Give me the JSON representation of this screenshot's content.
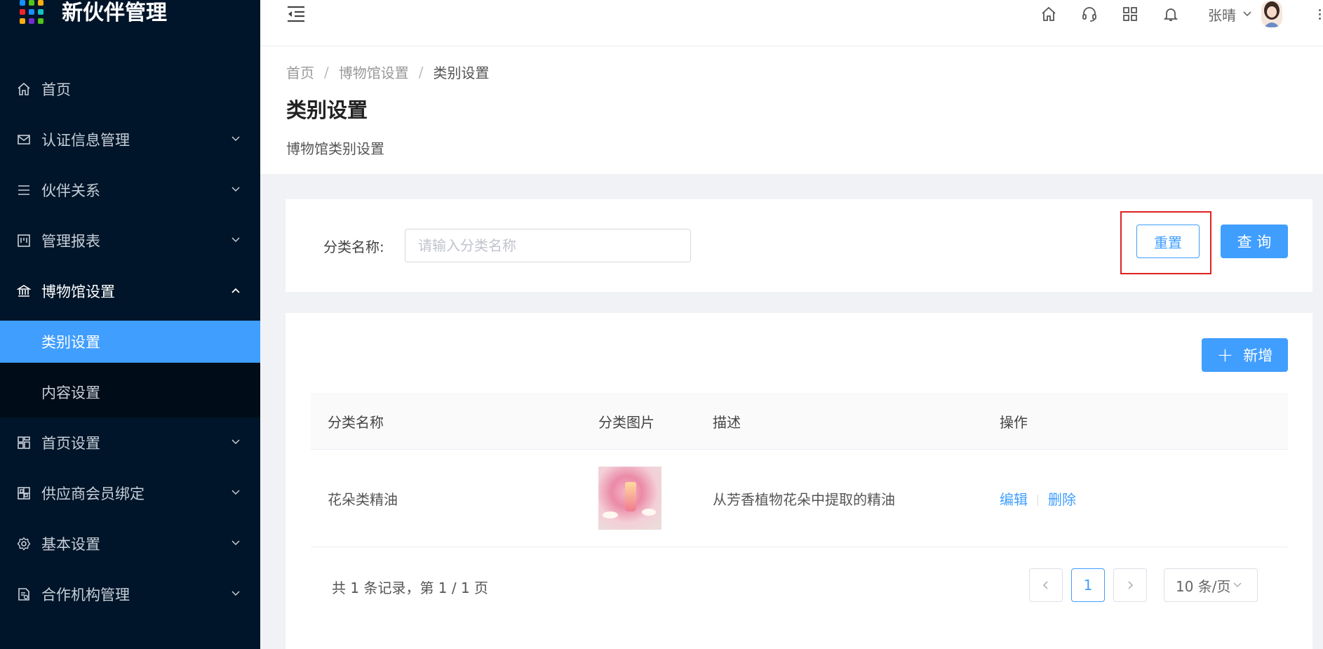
{
  "app": {
    "title": "新伙伴管理",
    "logo_colors": [
      "#1890ff",
      "#52c41a",
      "#faad14",
      "#f5222d",
      "#1890ff",
      "#13c2c2",
      "#faad14",
      "#722ed1",
      "#52c41a"
    ]
  },
  "sidebar": {
    "items": [
      {
        "label": "首页",
        "icon": "home-icon",
        "has_arrow": false
      },
      {
        "label": "认证信息管理",
        "icon": "mail-icon",
        "has_arrow": true
      },
      {
        "label": "伙伴关系",
        "icon": "list-icon",
        "has_arrow": true
      },
      {
        "label": "管理报表",
        "icon": "report-icon",
        "has_arrow": true
      },
      {
        "label": "博物馆设置",
        "icon": "bank-icon",
        "has_arrow": true,
        "open": true
      },
      {
        "label": "首页设置",
        "icon": "layout-icon",
        "has_arrow": true
      },
      {
        "label": "供应商会员绑定",
        "icon": "qrcode-icon",
        "has_arrow": true
      },
      {
        "label": "基本设置",
        "icon": "gear-icon",
        "has_arrow": true
      },
      {
        "label": "合作机构管理",
        "icon": "file-icon",
        "has_arrow": true
      }
    ],
    "submenu": [
      {
        "label": "类别设置",
        "active": true
      },
      {
        "label": "内容设置",
        "active": false
      }
    ]
  },
  "topbar": {
    "username": "张晴"
  },
  "breadcrumb": [
    "首页",
    "博物馆设置",
    "类别设置"
  ],
  "page": {
    "title": "类别设置",
    "description": "博物馆类别设置"
  },
  "search": {
    "label": "分类名称:",
    "placeholder": "请输入分类名称",
    "value": "",
    "reset_label": "重置",
    "query_label": "查 询"
  },
  "toolbar": {
    "add_label": "新增"
  },
  "table": {
    "columns": [
      "分类名称",
      "分类图片",
      "描述",
      "操作"
    ],
    "rows": [
      {
        "name": "花朵类精油",
        "description": "从芳香植物花朵中提取的精油",
        "edit": "编辑",
        "delete": "删除"
      }
    ]
  },
  "pagination": {
    "total_text": "共 1 条记录，第 1 / 1 页",
    "current_page": "1",
    "page_size": "10 条/页"
  },
  "colors": {
    "sidebar_bg": "#001529",
    "accent": "#409eff",
    "highlight": "#e02020"
  }
}
